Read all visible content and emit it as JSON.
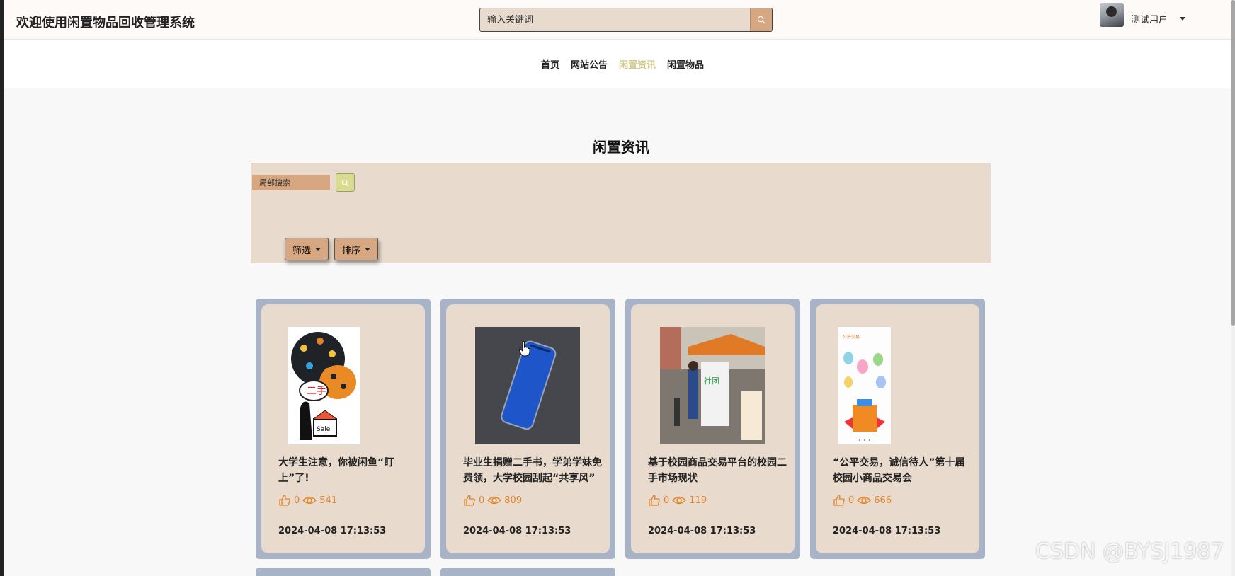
{
  "header": {
    "app_title": "欢迎使用闲置物品回收管理系统",
    "search_placeholder": "输入关键词",
    "user_name": "测试用户"
  },
  "nav": {
    "items": [
      {
        "label": "首页",
        "active": false
      },
      {
        "label": "网站公告",
        "active": false
      },
      {
        "label": "闲置资讯",
        "active": true
      },
      {
        "label": "闲置物品",
        "active": false
      }
    ]
  },
  "section": {
    "title": "闲置资讯",
    "local_search_placeholder": "局部搜索",
    "filter_label": "筛选",
    "sort_label": "排序"
  },
  "cards": [
    {
      "title": "大学生注意，你被闲鱼“盯上”了!",
      "likes": "0",
      "views": "541",
      "date": "2024-04-08 17:13:53",
      "image": "second-hand-sale-illustration"
    },
    {
      "title": "毕业生捐赠二手书，学弟学妹免费领，大学校园刮起“共享风”",
      "likes": "0",
      "views": "809",
      "date": "2024-04-08 17:13:53",
      "image": "blue-smartphone-photo"
    },
    {
      "title": "基于校园商品交易平台的校园二手市场现状",
      "likes": "0",
      "views": "119",
      "date": "2024-04-08 17:13:53",
      "image": "campus-market-photo"
    },
    {
      "title": "“公平交易，诚信待人”第十届校园小商品交易会",
      "likes": "0",
      "views": "666",
      "date": "2024-04-08 17:13:53",
      "image": "trade-fair-poster"
    }
  ],
  "watermark": "CSDN @BYSJ1987",
  "colors": {
    "header_bg": "#fefaf7",
    "panel_bg": "#e8dacc",
    "accent": "#d7a782",
    "nav_active": "#cfc88b",
    "card_frame": "#a9b3c8",
    "stats_color": "#e0832a"
  }
}
